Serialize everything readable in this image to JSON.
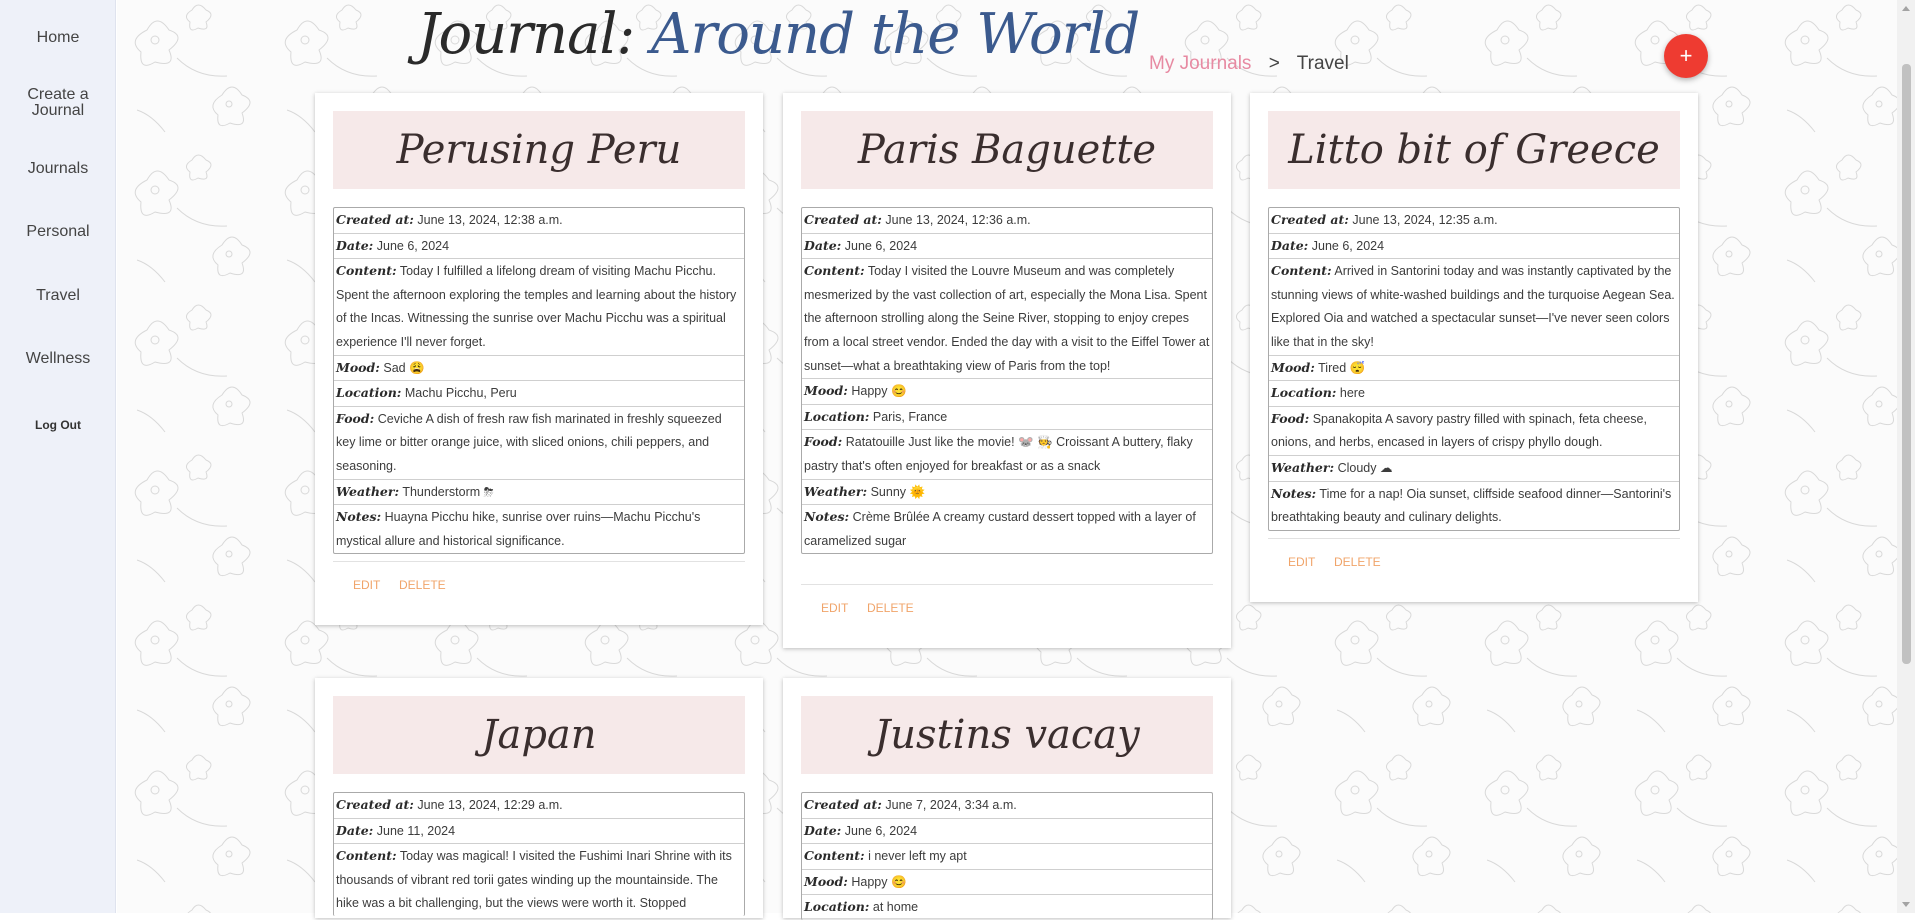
{
  "sidebar": {
    "items": [
      {
        "label": "Home"
      },
      {
        "label": "Create a Journal"
      },
      {
        "label": "Journals"
      },
      {
        "label": "Personal"
      },
      {
        "label": "Travel"
      },
      {
        "label": "Wellness"
      },
      {
        "label": "Log Out"
      }
    ]
  },
  "header": {
    "title_prefix": "Journal: ",
    "title_accent": "Around the World",
    "breadcrumb": {
      "link": "My Journals",
      "separator": ">",
      "current": "Travel"
    },
    "fab_label": "+"
  },
  "colors": {
    "accent": "#3b5a8e",
    "crumb_link": "#e78aa2",
    "fab": "#ee3b31",
    "action": "#f0a46a",
    "card_header": "#f6e9e9"
  },
  "labels": {
    "created": "Created at:",
    "date": "Date:",
    "content": "Content:",
    "mood": "Mood:",
    "location": "Location:",
    "food": "Food:",
    "weather": "Weather:",
    "notes": "Notes:",
    "edit": "EDIT",
    "delete": "DELETE"
  },
  "cards": [
    {
      "title": "Perusing Peru",
      "created": "June 13, 2024, 12:38 a.m.",
      "date": "June 6, 2024",
      "content": "Today I fulfilled a lifelong dream of visiting Machu Picchu. Spent the afternoon exploring the temples and learning about the history of the Incas. Witnessing the sunrise over Machu Picchu was a spiritual experience I'll never forget.",
      "mood": "Sad 😩",
      "location": "Machu Picchu, Peru",
      "food": "Ceviche A dish of fresh raw fish marinated in freshly squeezed key lime or bitter orange juice, with sliced onions, chili peppers, and seasoning.",
      "weather": "Thunderstorm ⛈",
      "notes": "Huayna Picchu hike, sunrise over ruins—Machu Picchu's mystical allure and historical significance."
    },
    {
      "title": "Paris Baguette",
      "created": "June 13, 2024, 12:36 a.m.",
      "date": "June 6, 2024",
      "content": "Today I visited the Louvre Museum and was completely mesmerized by the vast collection of art, especially the Mona Lisa. Spent the afternoon strolling along the Seine River, stopping to enjoy crepes from a local street vendor. Ended the day with a visit to the Eiffel Tower at sunset—what a breathtaking view of Paris from the top!",
      "mood": "Happy 😊",
      "location": "Paris, France",
      "food": "Ratatouille Just like the movie! 🐭 🧑‍🍳 Croissant A buttery, flaky pastry that's often enjoyed for breakfast or as a snack",
      "weather": "Sunny 🌞",
      "notes": "Crème Brûlée A creamy custard dessert topped with a layer of caramelized sugar"
    },
    {
      "title": "Litto bit of Greece",
      "created": "June 13, 2024, 12:35 a.m.",
      "date": "June 6, 2024",
      "content": "Arrived in Santorini today and was instantly captivated by the stunning views of white-washed buildings and the turquoise Aegean Sea. Explored Oia and watched a spectacular sunset—I've never seen colors like that in the sky!",
      "mood": "Tired 😴",
      "location": "here",
      "food": "Spanakopita A savory pastry filled with spinach, feta cheese, onions, and herbs, encased in layers of crispy phyllo dough.",
      "weather": "Cloudy ☁",
      "notes": "Time for a nap! Oia sunset, cliffside seafood dinner—Santorini's breathtaking beauty and culinary delights."
    },
    {
      "title": "Japan",
      "created": "June 13, 2024, 12:29 a.m.",
      "date": "June 11, 2024",
      "content": "Today was magical! I visited the Fushimi Inari Shrine with its thousands of vibrant red torii gates winding up the mountainside. The hike was a bit challenging, but the views were worth it. Stopped"
    },
    {
      "title": "Justins vacay",
      "created": "June 7, 2024, 3:34 a.m.",
      "date": "June 6, 2024",
      "content": "i never left my apt",
      "mood": "Happy 😊",
      "location": "at home"
    }
  ]
}
